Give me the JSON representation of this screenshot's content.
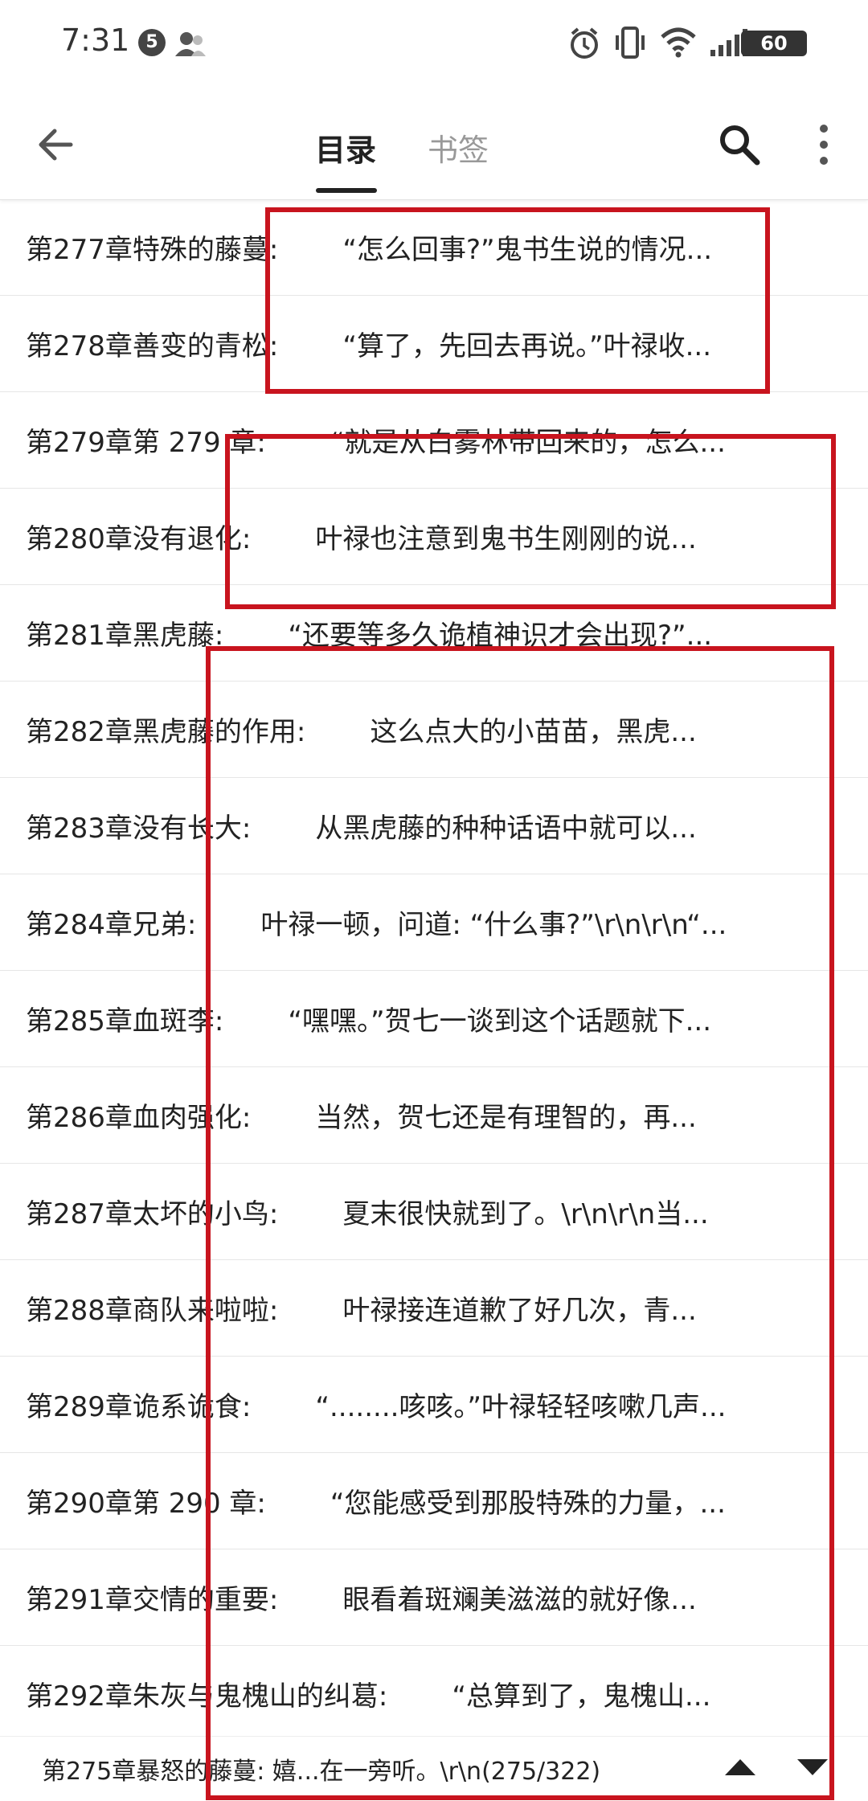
{
  "status_bar": {
    "time": "7:31",
    "notification_count": "5",
    "battery": "60",
    "icons": [
      "person-icon",
      "alarm-icon",
      "vibrate-icon",
      "wifi-icon",
      "signal-icon",
      "battery-icon"
    ]
  },
  "toolbar": {
    "tabs": [
      {
        "label": "目录",
        "selected": true
      },
      {
        "label": "书签",
        "selected": false
      }
    ]
  },
  "chapters": [
    {
      "title": "第277章特殊的藤蔓:",
      "preview": "“怎么回事?”鬼书生说的情况..."
    },
    {
      "title": "第278章善变的青松:",
      "preview": "“算了，先回去再说。”叶禄收..."
    },
    {
      "title": "第279章第 279 章:",
      "preview": "“就是从白雾林带回来的，怎么..."
    },
    {
      "title": "第280章没有退化:",
      "preview": "叶禄也注意到鬼书生刚刚的说..."
    },
    {
      "title": "第281章黑虎藤:",
      "preview": "“还要等多久诡植神识才会出现?”..."
    },
    {
      "title": "第282章黑虎藤的作用:",
      "preview": "这么点大的小苗苗，黑虎..."
    },
    {
      "title": "第283章没有长大:",
      "preview": "从黑虎藤的种种话语中就可以..."
    },
    {
      "title": "第284章兄弟:",
      "preview": "叶禄一顿，问道: “什么事?”\\r\\n\\r\\n“..."
    },
    {
      "title": "第285章血斑李:",
      "preview": "“嘿嘿。”贺七一谈到这个话题就下..."
    },
    {
      "title": "第286章血肉强化:",
      "preview": "当然，贺七还是有理智的，再..."
    },
    {
      "title": "第287章太坏的小鸟:",
      "preview": "夏末很快就到了。\\r\\n\\r\\n当..."
    },
    {
      "title": "第288章商队来啦啦:",
      "preview": "叶禄接连道歉了好几次，青..."
    },
    {
      "title": "第289章诡系诡食:",
      "preview": "“........咳咳。”叶禄轻轻咳嗽几声..."
    },
    {
      "title": "第290章第 290 章:",
      "preview": "“您能感受到那股特殊的力量，..."
    },
    {
      "title": "第291章交情的重要:",
      "preview": "眼看着斑斓美滋滋的就好像..."
    },
    {
      "title": "第292章朱灰与鬼槐山的纠葛:",
      "preview": "“总算到了，鬼槐山..."
    }
  ],
  "bottom_bar": {
    "current_text": "第275章暴怒的藤蔓:     嬉...在一旁听。\\r\\n(275/322)"
  },
  "colors": {
    "annotation": "#c8141e",
    "text": "#222222",
    "inactive_tab": "#999999"
  }
}
